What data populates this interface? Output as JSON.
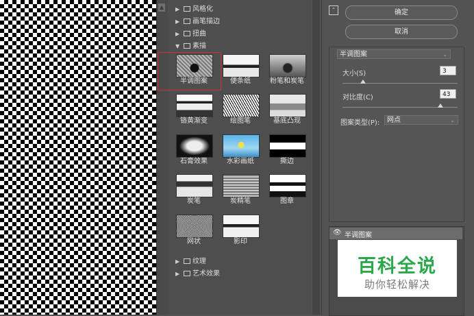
{
  "gallery": {
    "categories_top": [
      {
        "label": "风格化",
        "expanded": false
      },
      {
        "label": "画笔描边",
        "expanded": false
      },
      {
        "label": "扭曲",
        "expanded": false
      },
      {
        "label": "素描",
        "expanded": true
      }
    ],
    "filters": [
      {
        "label": "半调图案",
        "selected": true
      },
      {
        "label": "便条纸"
      },
      {
        "label": "粉笔和炭笔"
      },
      {
        "label": "铬黄渐变"
      },
      {
        "label": "绘图笔"
      },
      {
        "label": "基底凸现"
      },
      {
        "label": "石膏效果"
      },
      {
        "label": "水彩画纸"
      },
      {
        "label": "撕边"
      },
      {
        "label": "炭笔"
      },
      {
        "label": "炭精笔"
      },
      {
        "label": "图章"
      },
      {
        "label": "网状"
      },
      {
        "label": "影印"
      }
    ],
    "categories_bottom": [
      {
        "label": "纹理",
        "expanded": false
      },
      {
        "label": "艺术效果",
        "expanded": false
      }
    ]
  },
  "buttons": {
    "ok": "确定",
    "cancel": "取消"
  },
  "settings": {
    "filter_select": "半调图案",
    "size_label": "大小(S)",
    "size_value": "3",
    "contrast_label": "对比度(C)",
    "contrast_value": "43",
    "pattern_type_label": "图案类型(P):",
    "pattern_type_value": "网点"
  },
  "layers": {
    "item_label": "半调图案"
  },
  "watermark": {
    "title": "百科全说",
    "subtitle": "助你轻松解决"
  },
  "icons": {
    "eye": "eye-icon",
    "collapse": "collapse-icon",
    "folder": "folder-icon",
    "scroll_up": "scroll-up-arrow-icon"
  }
}
